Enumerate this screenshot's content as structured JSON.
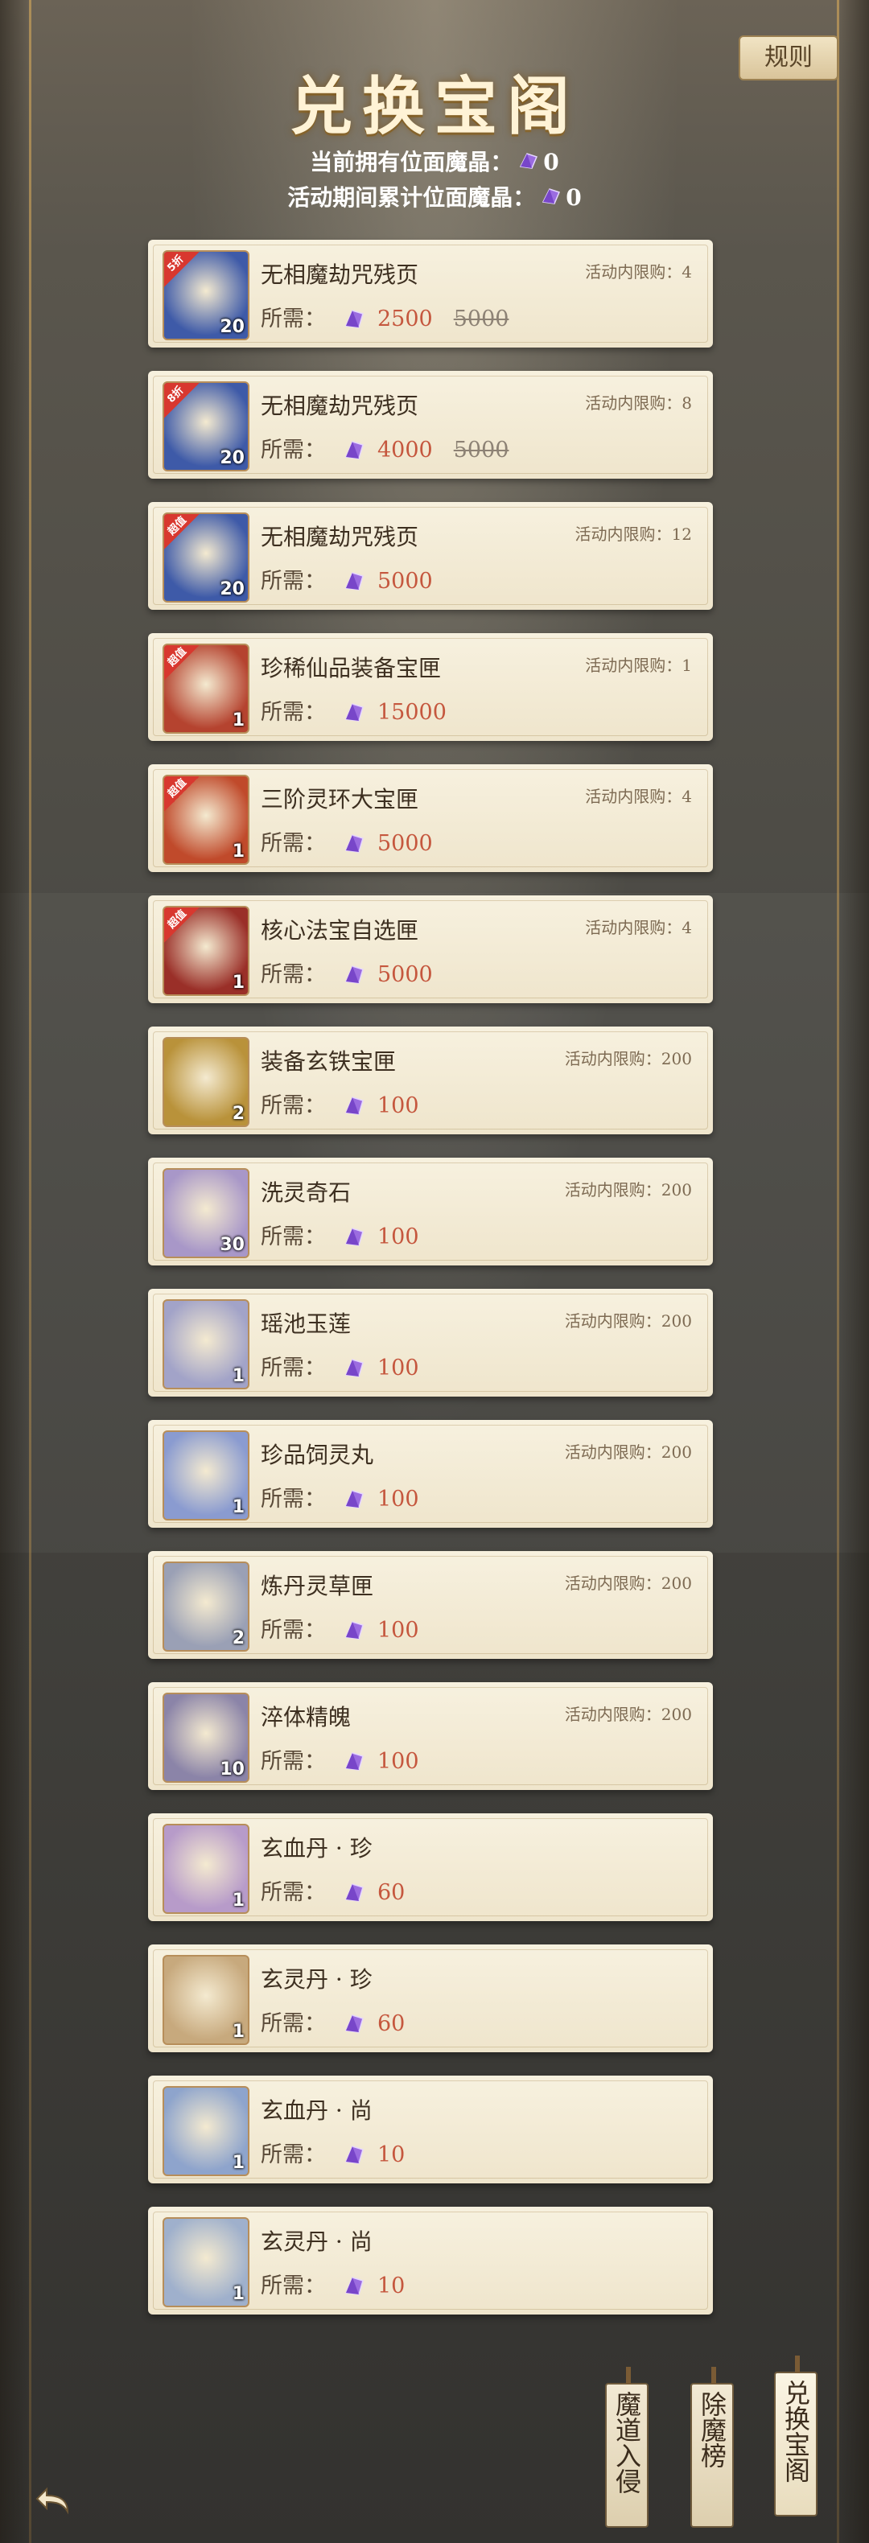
{
  "header": {
    "title": "兑换宝阁",
    "rules_label": "规则",
    "owned_label": "当前拥有位面魔晶：",
    "owned_value": "0",
    "cumulative_label": "活动期间累计位面魔晶：",
    "cumulative_value": "0"
  },
  "labels": {
    "price_label": "所需："
  },
  "items": [
    {
      "name": "无相魔劫咒残页",
      "limit": "活动内限购：4",
      "price": "2500",
      "original_price": "5000",
      "qty": "20",
      "tag": "5折",
      "icon": "scroll-icon",
      "color": "#3e5aa8"
    },
    {
      "name": "无相魔劫咒残页",
      "limit": "活动内限购：8",
      "price": "4000",
      "original_price": "5000",
      "qty": "20",
      "tag": "8折",
      "icon": "scroll-icon",
      "color": "#3e5aa8"
    },
    {
      "name": "无相魔劫咒残页",
      "limit": "活动内限购：12",
      "price": "5000",
      "original_price": "",
      "qty": "20",
      "tag": "超值",
      "icon": "scroll-icon",
      "color": "#3e5aa8"
    },
    {
      "name": "珍稀仙品装备宝匣",
      "limit": "活动内限购：1",
      "price": "15000",
      "original_price": "",
      "qty": "1",
      "tag": "超值",
      "icon": "equipment-chest-icon",
      "color": "#b5432f"
    },
    {
      "name": "三阶灵环大宝匣",
      "limit": "活动内限购：4",
      "price": "5000",
      "original_price": "",
      "qty": "1",
      "tag": "超值",
      "icon": "ring-chest-icon",
      "color": "#c04a2b"
    },
    {
      "name": "核心法宝自选匣",
      "limit": "活动内限购：4",
      "price": "5000",
      "original_price": "",
      "qty": "1",
      "tag": "超值",
      "icon": "treasure-chest-icon",
      "color": "#9a2f28"
    },
    {
      "name": "装备玄铁宝匣",
      "limit": "活动内限购：200",
      "price": "100",
      "original_price": "",
      "qty": "2",
      "tag": "",
      "icon": "iron-chest-icon",
      "color": "#b9923a"
    },
    {
      "name": "洗灵奇石",
      "limit": "活动内限购：200",
      "price": "100",
      "original_price": "",
      "qty": "30",
      "tag": "",
      "icon": "stone-icon",
      "color": "#a897c8"
    },
    {
      "name": "瑶池玉莲",
      "limit": "活动内限购：200",
      "price": "100",
      "original_price": "",
      "qty": "1",
      "tag": "",
      "icon": "lotus-icon",
      "color": "#a2a3c8"
    },
    {
      "name": "珍品饲灵丸",
      "limit": "活动内限购：200",
      "price": "100",
      "original_price": "",
      "qty": "1",
      "tag": "",
      "icon": "orb-icon",
      "color": "#8a9bd0"
    },
    {
      "name": "炼丹灵草匣",
      "limit": "活动内限购：200",
      "price": "100",
      "original_price": "",
      "qty": "2",
      "tag": "",
      "icon": "herb-chest-icon",
      "color": "#9aa0b5"
    },
    {
      "name": "淬体精魄",
      "limit": "活动内限购：200",
      "price": "100",
      "original_price": "",
      "qty": "10",
      "tag": "",
      "icon": "essence-icon",
      "color": "#8b84a8"
    },
    {
      "name": "玄血丹 · 珍",
      "limit": "",
      "price": "60",
      "original_price": "",
      "qty": "1",
      "tag": "",
      "icon": "pill-purple-icon",
      "color": "#b79bc9"
    },
    {
      "name": "玄灵丹 · 珍",
      "limit": "",
      "price": "60",
      "original_price": "",
      "qty": "1",
      "tag": "",
      "icon": "pill-gold-icon",
      "color": "#c7a97d"
    },
    {
      "name": "玄血丹 · 尚",
      "limit": "",
      "price": "10",
      "original_price": "",
      "qty": "1",
      "tag": "",
      "icon": "pill-purple-icon",
      "color": "#8ea4cc"
    },
    {
      "name": "玄灵丹 · 尚",
      "limit": "",
      "price": "10",
      "original_price": "",
      "qty": "1",
      "tag": "",
      "icon": "pill-gold-icon",
      "color": "#9fb0cc"
    }
  ],
  "bottom_tabs": [
    {
      "label": "魔道入侵",
      "active": false
    },
    {
      "label": "除魔榜",
      "active": false
    },
    {
      "label": "兑换宝阁",
      "active": true
    }
  ],
  "colors": {
    "price": "#c5573e",
    "tag_red": "#d8382f",
    "card_bg": "#f7f1df"
  }
}
